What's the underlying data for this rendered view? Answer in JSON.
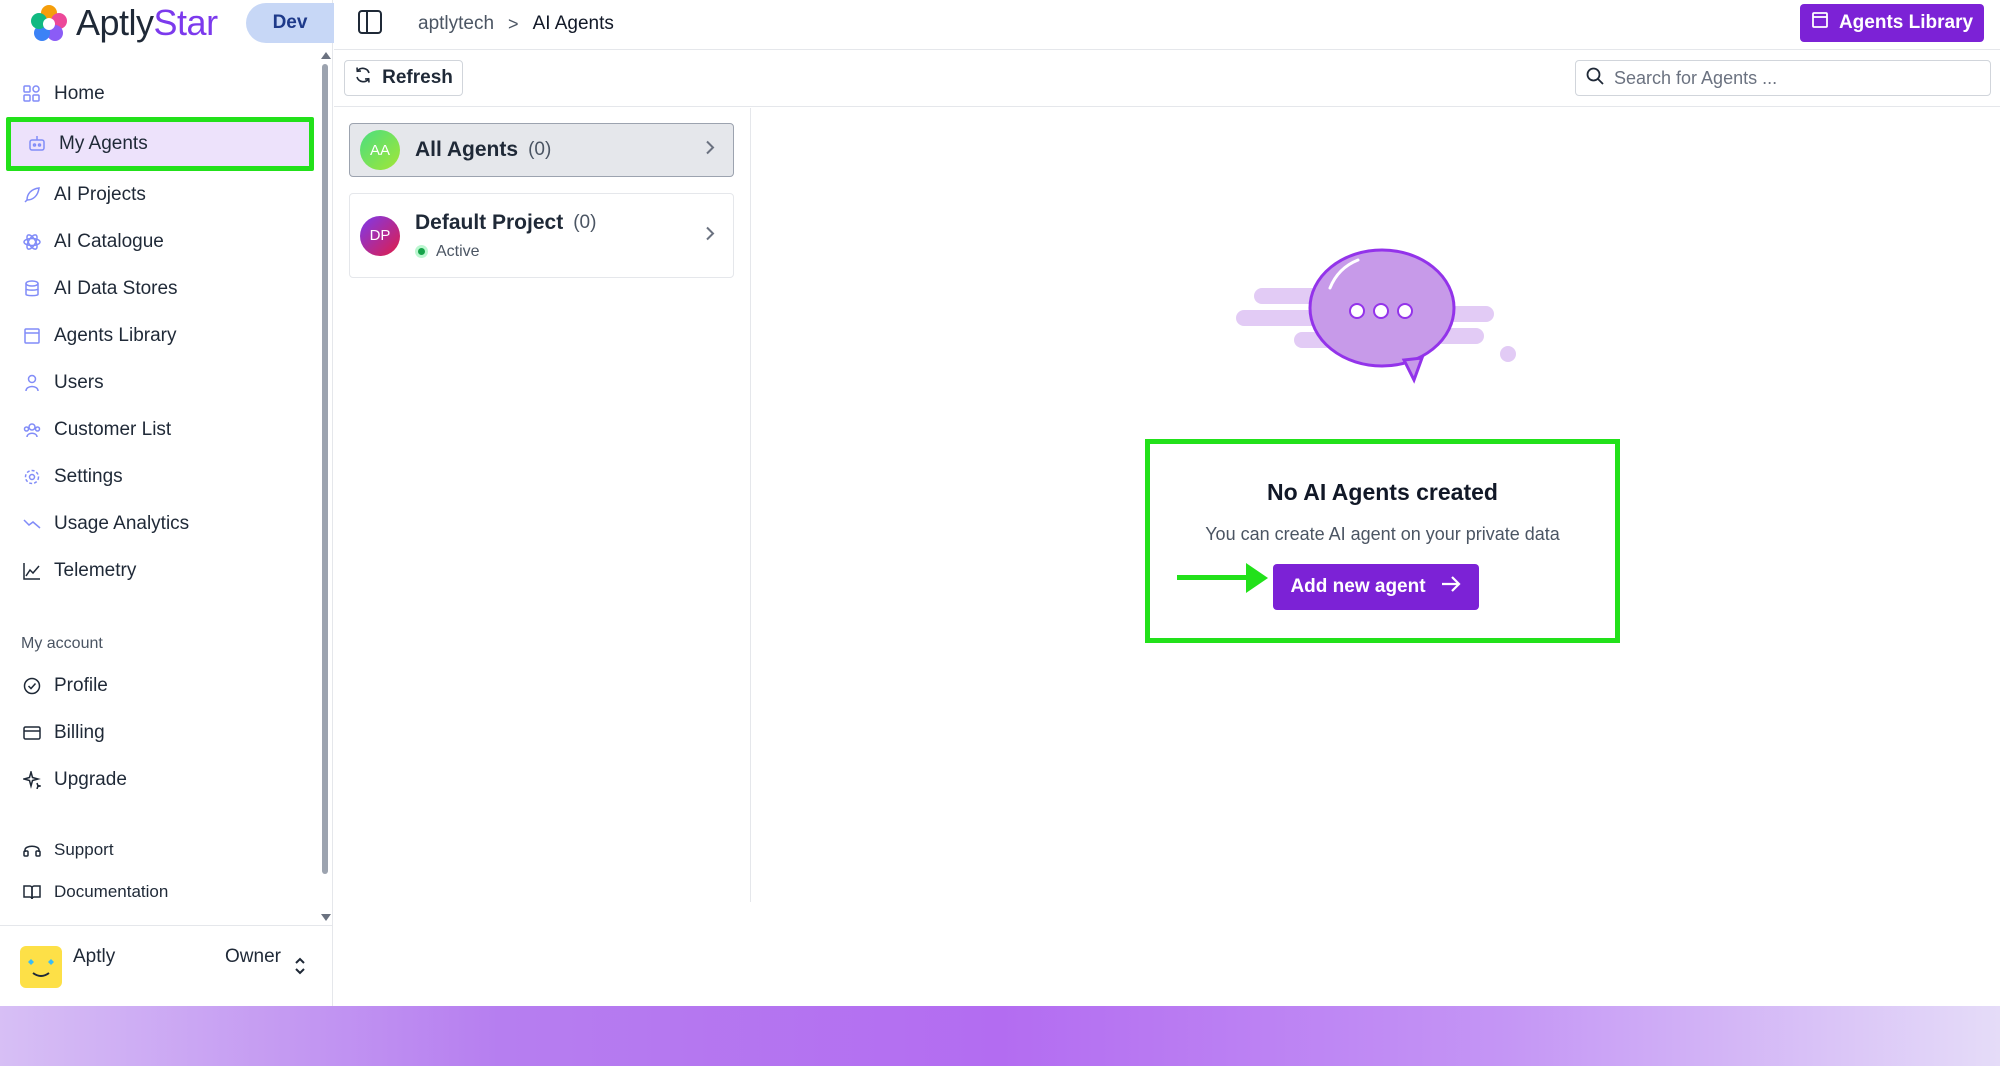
{
  "brand": {
    "name_part1": "Aptly",
    "name_part2": "Star",
    "env": "Dev"
  },
  "breadcrumb": {
    "org": "aptlytech",
    "separator": ">",
    "current": "AI Agents"
  },
  "header": {
    "library_button": "Agents Library"
  },
  "toolbar": {
    "refresh_label": "Refresh",
    "search_placeholder": "Search for Agents ..."
  },
  "sidebar": {
    "items": [
      {
        "label": "Home",
        "icon": "home-icon"
      },
      {
        "label": "My Agents",
        "icon": "robot-icon"
      },
      {
        "label": "AI Projects",
        "icon": "rocket-icon"
      },
      {
        "label": "AI Catalogue",
        "icon": "atom-icon"
      },
      {
        "label": "AI Data Stores",
        "icon": "database-icon"
      },
      {
        "label": "Agents Library",
        "icon": "archive-icon"
      },
      {
        "label": "Users",
        "icon": "user-icon"
      },
      {
        "label": "Customer List",
        "icon": "users-icon"
      },
      {
        "label": "Settings",
        "icon": "gear-icon"
      },
      {
        "label": "Usage Analytics",
        "icon": "trend-icon"
      },
      {
        "label": "Telemetry",
        "icon": "chart-icon"
      }
    ],
    "account_heading": "My account",
    "account_items": [
      {
        "label": "Profile",
        "icon": "badge-check-icon"
      },
      {
        "label": "Billing",
        "icon": "card-icon"
      },
      {
        "label": "Upgrade",
        "icon": "sparkle-icon"
      }
    ],
    "help_items": [
      {
        "label": "Support",
        "icon": "headset-icon"
      },
      {
        "label": "Documentation",
        "icon": "book-icon"
      }
    ],
    "user": {
      "name": "Aptly",
      "role": "Owner"
    }
  },
  "projects": [
    {
      "initials": "AA",
      "name": "All Agents",
      "count": "(0)"
    },
    {
      "initials": "DP",
      "name": "Default Project",
      "count": "(0)",
      "status": "Active"
    }
  ],
  "empty_state": {
    "title": "No AI Agents created",
    "subtitle": "You can create AI agent on your private data",
    "button": "Add new agent"
  },
  "colors": {
    "accent": "#7c22d6",
    "highlight": "#22e11a",
    "active_bg": "#ede2fb"
  }
}
